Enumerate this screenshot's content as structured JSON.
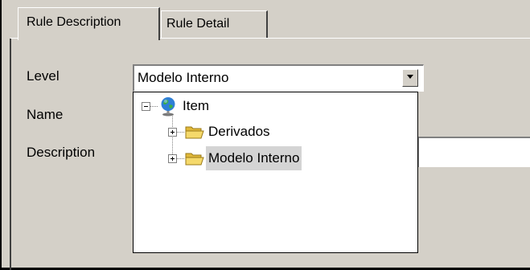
{
  "tabs": [
    {
      "label": "Rule Description",
      "active": true
    },
    {
      "label": "Rule Detail",
      "active": false
    }
  ],
  "form": {
    "level_label": "Level",
    "name_label": "Name",
    "description_label": "Description",
    "level_value": "Modelo Interno"
  },
  "tree": {
    "root": {
      "label": "Item",
      "icon": "globe-icon",
      "expanded": true
    },
    "children": [
      {
        "label": "Derivados",
        "icon": "folder-icon",
        "expanded": false,
        "selected": false
      },
      {
        "label": "Modelo Interno",
        "icon": "folder-icon",
        "expanded": false,
        "selected": true
      }
    ]
  },
  "colors": {
    "window_bg": "#d4d0c8",
    "folder": "#f5d96b",
    "selection": "#d4d4d4"
  }
}
